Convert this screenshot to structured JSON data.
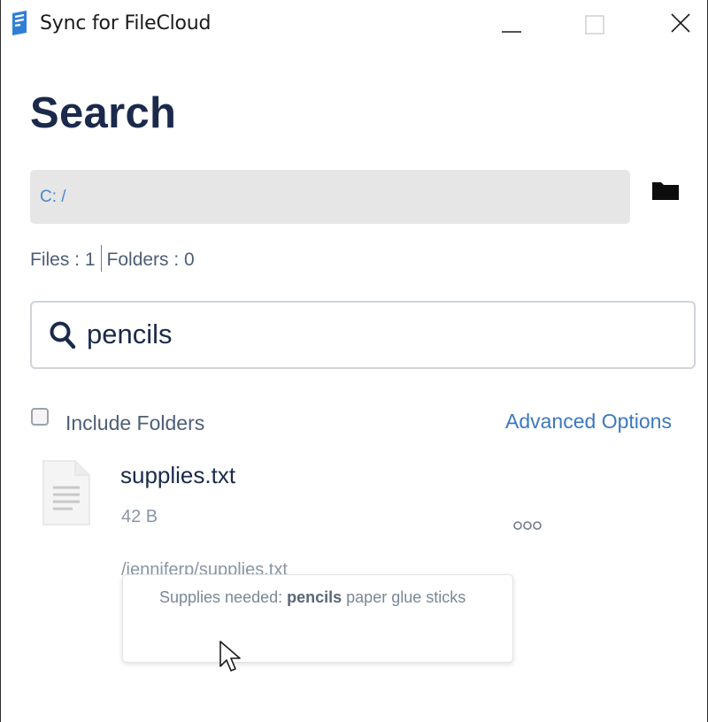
{
  "window": {
    "title": "Sync for FileCloud",
    "controls": {
      "minimize": "minimize-icon",
      "maximize": "maximize-icon",
      "close": "close-icon"
    }
  },
  "page": {
    "title": "Search"
  },
  "location": {
    "path": "C: /",
    "browse_icon": "folder-icon"
  },
  "counts": {
    "files": "Files : 1",
    "folders": "Folders : 0"
  },
  "search": {
    "icon": "search-icon",
    "value": "pencils"
  },
  "options": {
    "include_folders_label": "Include Folders",
    "include_folders_checked": false,
    "advanced_options_label": "Advanced Options"
  },
  "results": [
    {
      "icon": "text-file-icon",
      "name": "supplies.txt",
      "size": "42 B",
      "path": "/jenniferp/supplies.txt",
      "more_icon": "more-options-icon",
      "snippet_before": "Supplies needed: ",
      "snippet_match": "pencils",
      "snippet_after": " paper glue sticks"
    }
  ],
  "colors": {
    "heading": "#1b2a4b",
    "link": "#3c78c0",
    "path_text": "#4b87c8",
    "path_bg": "#e6e6e6",
    "muted_text": "#8a95a5"
  }
}
